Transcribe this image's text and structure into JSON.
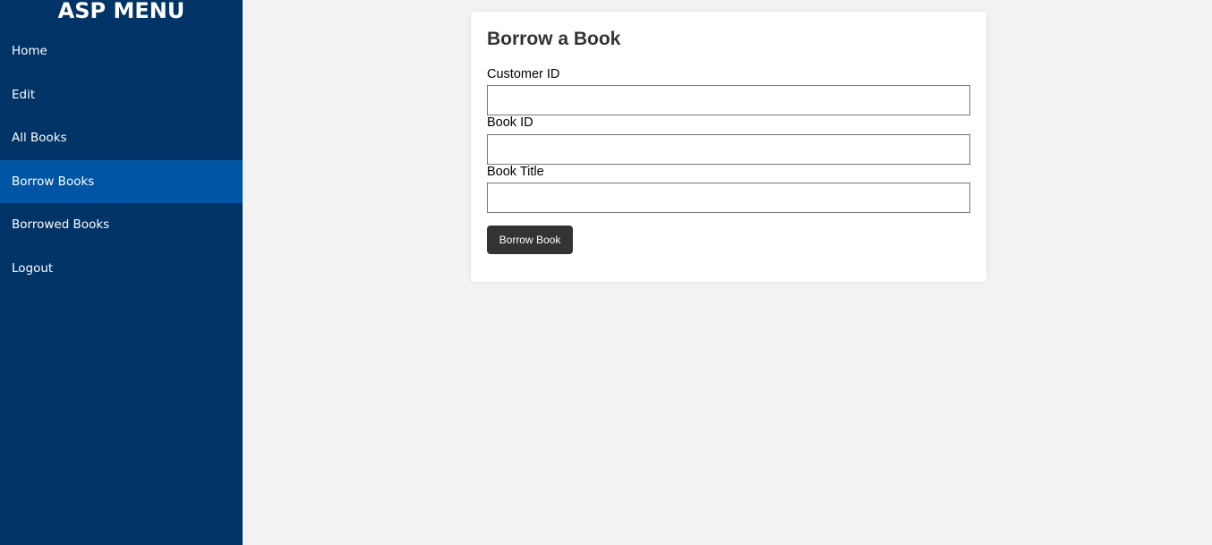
{
  "sidebar": {
    "title": "ASP MENU",
    "items": [
      {
        "label": "Home"
      },
      {
        "label": "Edit"
      },
      {
        "label": "All Books"
      },
      {
        "label": "Borrow Books"
      },
      {
        "label": "Borrowed Books"
      },
      {
        "label": "Logout"
      }
    ],
    "active_item": "Borrow Books"
  },
  "form": {
    "title": "Borrow a Book",
    "fields": [
      {
        "label": "Customer ID",
        "value": "",
        "placeholder": ""
      },
      {
        "label": "Book ID",
        "value": "",
        "placeholder": ""
      },
      {
        "label": "Book Title",
        "value": "",
        "placeholder": ""
      }
    ],
    "submit_label": "Borrow Book"
  },
  "colors": {
    "sidebar_bg": "#003366",
    "sidebar_active_bg": "#0055a5",
    "page_bg": "#f2f2f2",
    "button_bg": "#333333"
  }
}
